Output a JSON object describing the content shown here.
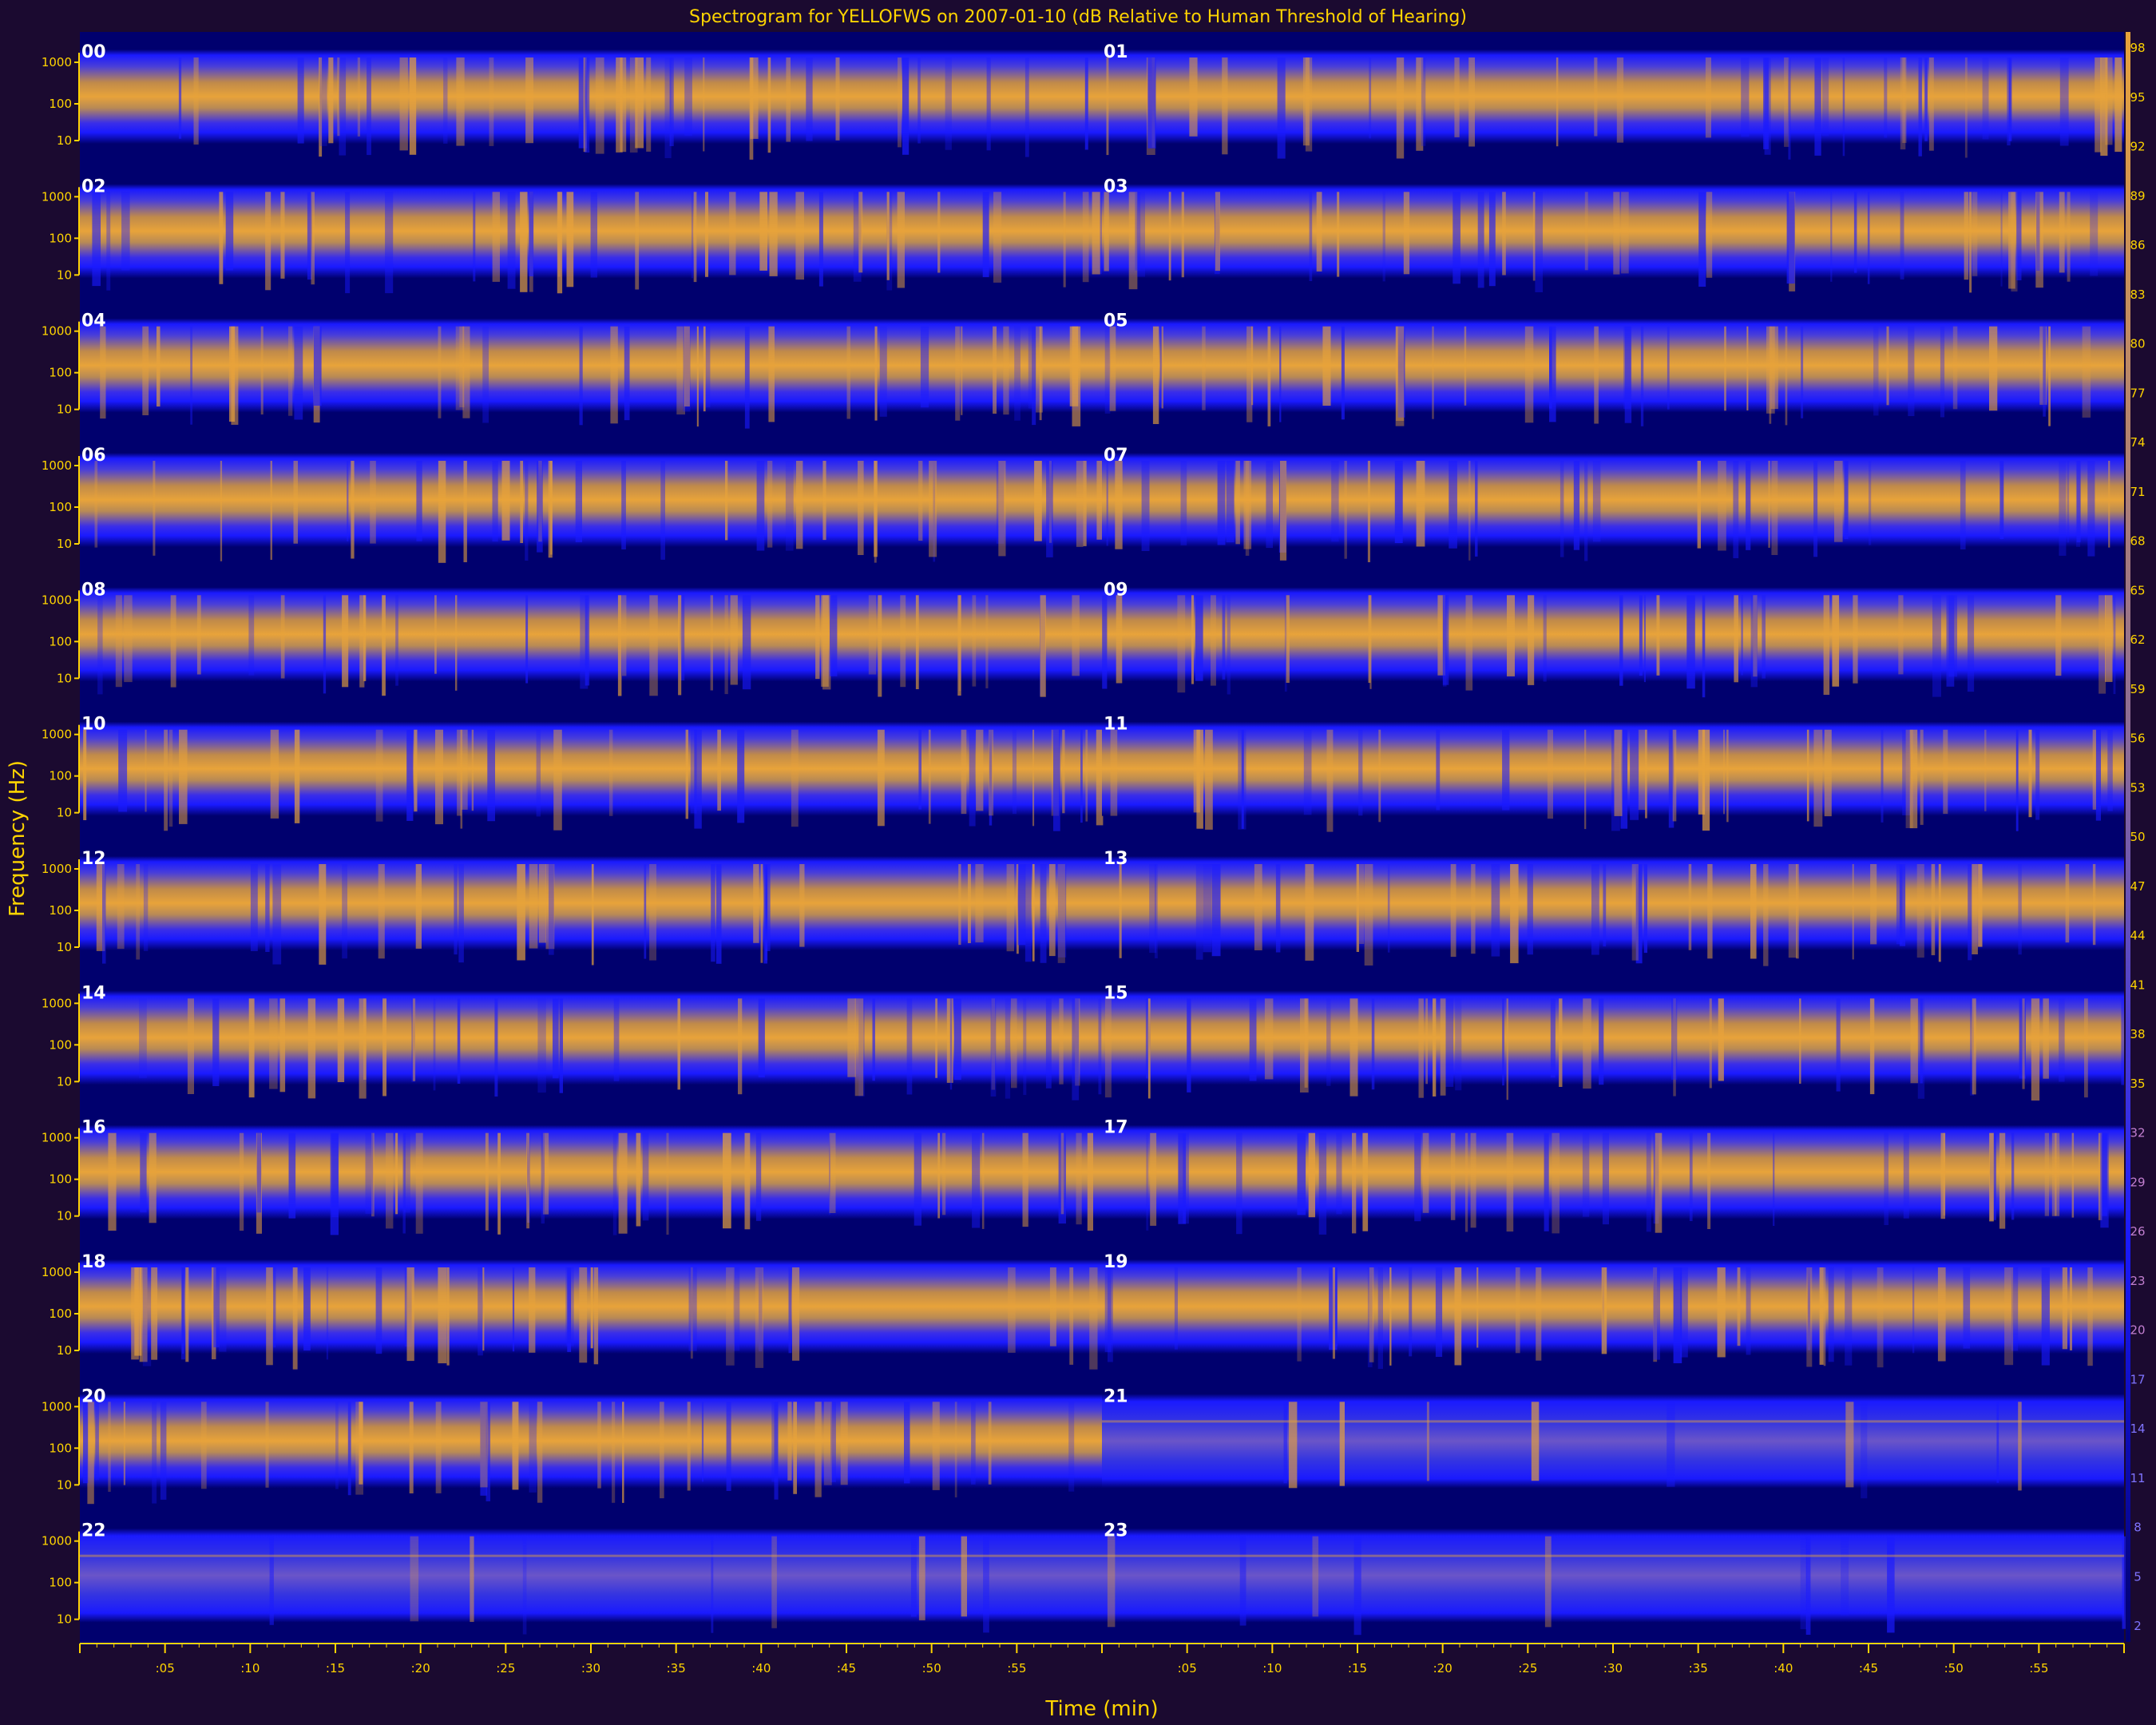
{
  "chart_data": {
    "type": "heatmap",
    "title": "Spectrogram for YELLOFWS on 2007-01-10 (dB Relative to Human Threshold of Hearing)",
    "xlabel": "Time (min)",
    "ylabel": "Frequency (Hz)",
    "rows": [
      {
        "left_label": "00",
        "right_label": "01"
      },
      {
        "left_label": "02",
        "right_label": "03"
      },
      {
        "left_label": "04",
        "right_label": "05"
      },
      {
        "left_label": "06",
        "right_label": "07"
      },
      {
        "left_label": "08",
        "right_label": "09"
      },
      {
        "left_label": "10",
        "right_label": "11"
      },
      {
        "left_label": "12",
        "right_label": "13"
      },
      {
        "left_label": "14",
        "right_label": "15"
      },
      {
        "left_label": "16",
        "right_label": "17"
      },
      {
        "left_label": "18",
        "right_label": "19"
      },
      {
        "left_label": "20",
        "right_label": "21"
      },
      {
        "left_label": "22",
        "right_label": "23"
      }
    ],
    "y_ticks": [
      "1000",
      "100",
      "10"
    ],
    "x_ticks": [
      ":05",
      ":10",
      ":15",
      ":20",
      ":25",
      ":30",
      ":35",
      ":40",
      ":45",
      ":50",
      ":55",
      ":05",
      ":10",
      ":15",
      ":20",
      ":25",
      ":30",
      ":35",
      ":40",
      ":45",
      ":50",
      ":55"
    ],
    "x_range_min": [
      0,
      120
    ],
    "colorbar_ticks": [
      98,
      95,
      92,
      89,
      86,
      83,
      80,
      77,
      74,
      71,
      68,
      65,
      62,
      59,
      56,
      53,
      50,
      47,
      44,
      41,
      38,
      35,
      32,
      29,
      26,
      23,
      20,
      17,
      14,
      11,
      8,
      5,
      2
    ],
    "colorbar_range_db": [
      2,
      98
    ],
    "colors": {
      "background": "#1b0a30",
      "low": "#00006e",
      "mid": "#1a1aff",
      "high": "#e8a33a",
      "axis": "#ffd400"
    }
  }
}
